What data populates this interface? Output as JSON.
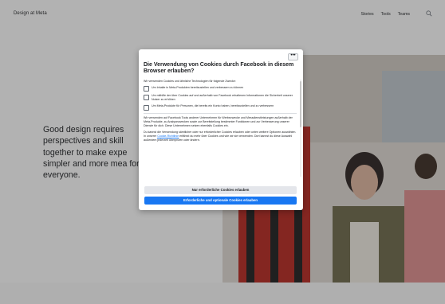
{
  "header": {
    "brand": "Design at Meta",
    "nav": [
      "Stories",
      "Tools",
      "Teams"
    ]
  },
  "hero": {
    "text": "Good design requires perspectives and skill together to make expe simpler and more mea for everyone."
  },
  "dialog": {
    "more_label": "•••",
    "title": "Die Verwendung von Cookies durch Facebook in diesem Browser erlauben?",
    "intro": "Wir verwenden Cookies und ähnliche Technologien für folgende Zwecke:",
    "purposes": [
      "Um Inhalte in Meta-Produkten bereitzustellen und verbessern zu können",
      "Um mithilfe der über Cookies auf und außerhalb von Facebook erhaltenen Informationen die Sicherheit unserer Nutzer zu erhöhen",
      "Um Meta-Produkte für Personen, die bereits ein Konto haben, bereitzustellen und zu verbessern"
    ],
    "para_tools": "Wir verwenden auf Facebook Tools anderer Unternehmen für Werbezwecke und Messdienstleistungen außerhalb der Meta-Produkte, zu Analysezwecken sowie zur Bereitstellung bestimmter Funktionen und zur Verbesserung unserer Dienste für dich. Diese Unternehmen setzen ebenfalls Cookies ein.",
    "para_choice_before": "Du kannst die Verwendung sämtlicher oder nur erforderlicher Cookies erlauben oder unten weitere Optionen auswählen. In unserer ",
    "policy_link": "Cookie-Richtlinie",
    "para_choice_after": " erfährst du mehr über Cookies und wie wir sie verwenden. Dort kannst du diese Auswahl außerdem jederzeit überprüfen oder ändern.",
    "btn_essential": "Nur erforderliche Cookies erlauben",
    "btn_all": "Erforderliche und optionale Cookies erlauben"
  },
  "colors": {
    "primary": "#1877f2",
    "secondary_button": "#e4e6eb",
    "overlay": "rgba(40,40,40,0.33)"
  },
  "icons": [
    "search-icon",
    "more-icon",
    "checkbox-icon"
  ]
}
